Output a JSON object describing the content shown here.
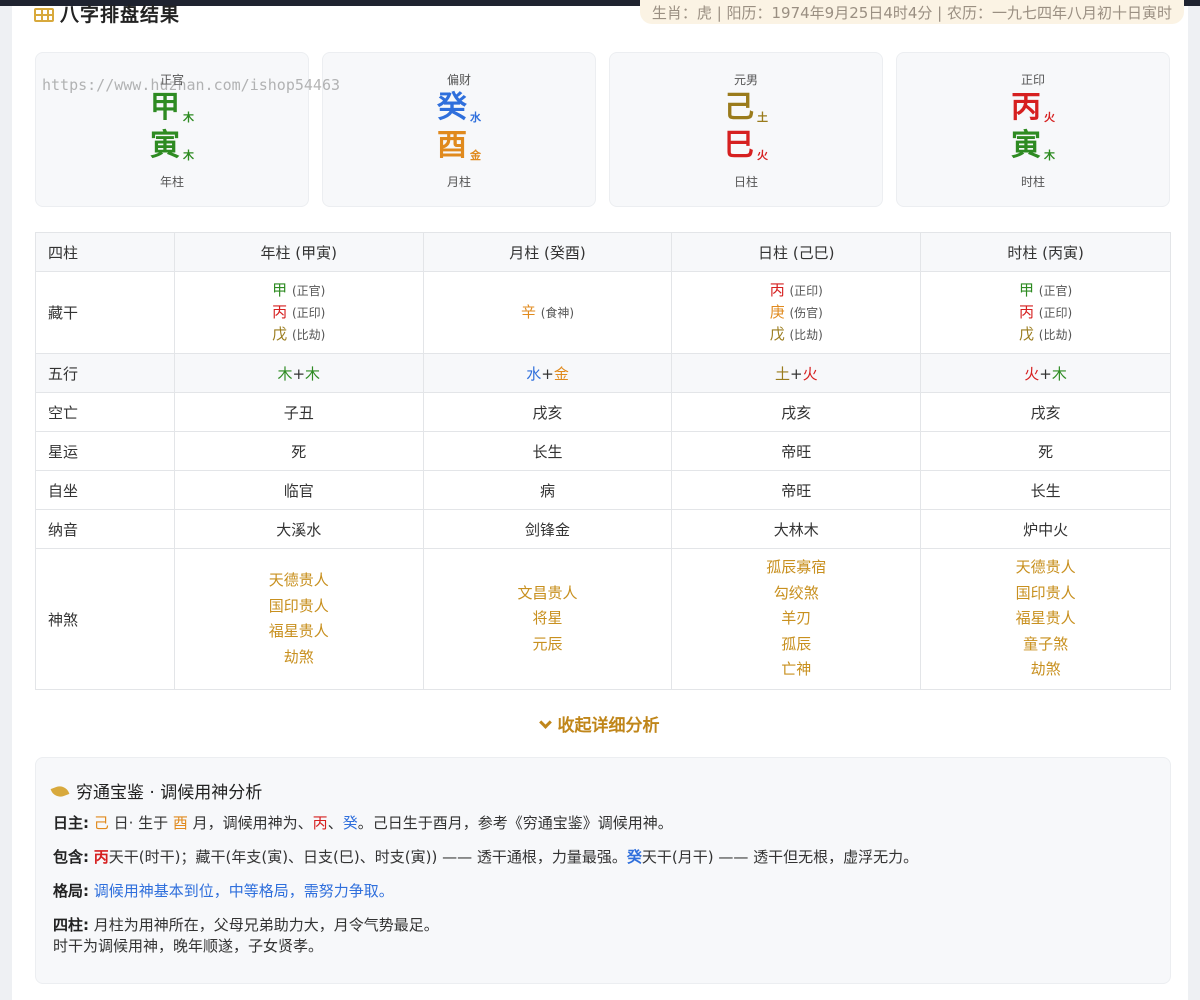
{
  "header": {
    "title": "八字排盘结果",
    "birth_info": "生肖：虎 | 阳历：1974年9月25日4时4分 | 农历：一九七四年八月初十日寅时"
  },
  "watermark": "https://www.huzhan.com/ishop54463",
  "pillars": [
    {
      "god": "正官",
      "stem": "甲",
      "stem_elem": "木",
      "branch": "寅",
      "branch_elem": "木",
      "name": "年柱"
    },
    {
      "god": "偏财",
      "stem": "癸",
      "stem_elem": "水",
      "branch": "酉",
      "branch_elem": "金",
      "name": "月柱"
    },
    {
      "god": "元男",
      "stem": "己",
      "stem_elem": "土",
      "branch": "巳",
      "branch_elem": "火",
      "name": "日柱"
    },
    {
      "god": "正印",
      "stem": "丙",
      "stem_elem": "火",
      "branch": "寅",
      "branch_elem": "木",
      "name": "时柱"
    }
  ],
  "table": {
    "headers": [
      "四柱",
      "年柱 (甲寅)",
      "月柱 (癸酉)",
      "日柱 (己巳)",
      "时柱 (丙寅)"
    ],
    "cang_label": "藏干",
    "cang": [
      [
        {
          "c": "甲",
          "g": "(正官)"
        },
        {
          "c": "丙",
          "g": "(正印)"
        },
        {
          "c": "戊",
          "g": "(比劫)"
        }
      ],
      [
        {
          "c": "辛",
          "g": "(食神)"
        }
      ],
      [
        {
          "c": "丙",
          "g": "(正印)"
        },
        {
          "c": "庚",
          "g": "(伤官)"
        },
        {
          "c": "戊",
          "g": "(比劫)"
        }
      ],
      [
        {
          "c": "甲",
          "g": "(正官)"
        },
        {
          "c": "丙",
          "g": "(正印)"
        },
        {
          "c": "戊",
          "g": "(比劫)"
        }
      ]
    ],
    "wuxing_label": "五行",
    "wuxing": [
      {
        "a": "木",
        "plus": "+",
        "b": "木"
      },
      {
        "a": "水",
        "plus": "+",
        "b": "金"
      },
      {
        "a": "土",
        "plus": "+",
        "b": "火"
      },
      {
        "a": "火",
        "plus": "+",
        "b": "木"
      }
    ],
    "kongwang_label": "空亡",
    "kongwang": [
      "子丑",
      "戌亥",
      "戌亥",
      "戌亥"
    ],
    "xingyun_label": "星运",
    "xingyun": [
      "死",
      "长生",
      "帝旺",
      "死"
    ],
    "zizuo_label": "自坐",
    "zizuo": [
      "临官",
      "病",
      "帝旺",
      "长生"
    ],
    "nayin_label": "纳音",
    "nayin": [
      "大溪水",
      "剑锋金",
      "大林木",
      "炉中火"
    ],
    "shensha_label": "神煞",
    "shensha": [
      [
        "天德贵人",
        "国印贵人",
        "福星贵人",
        "劫煞"
      ],
      [
        "文昌贵人",
        "将星",
        "元辰"
      ],
      [
        "孤辰寡宿",
        "勾绞煞",
        "羊刃",
        "孤辰",
        "亡神"
      ],
      [
        "天德贵人",
        "国印贵人",
        "福星贵人",
        "童子煞",
        "劫煞"
      ]
    ]
  },
  "collapse_label": "收起详细分析",
  "analysis": {
    "title": "穷通宝鉴 · 调候用神分析",
    "rizhu": {
      "key": "日主:",
      "p1": "己",
      "p2": " 日· 生于 ",
      "p3": "酉",
      "p4": " 月，调候用神为、",
      "p5": "丙",
      "p6": "、",
      "p7": "癸",
      "p8": "。己日生于酉月，参考《穷通宝鉴》调候用神。"
    },
    "baohan": {
      "key": "包含:",
      "p1": "丙",
      "p2": "天干(时干)；藏干(年支(寅)、日支(巳)、时支(寅)) —— 透干通根，力量最强。",
      "p3": "癸",
      "p4": "天干(月干) —— 透干但无根，虚浮无力。"
    },
    "geju": {
      "key": "格局:",
      "text": "调候用神基本到位，中等格局，需努力争取。"
    },
    "sizhu": {
      "key": "四柱:",
      "line1": "月柱为用神所在，父母兄弟助力大，月令气势最足。",
      "line2": "时干为调候用神，晚年顺遂，子女贤孝。"
    }
  },
  "colors": {
    "wood": "#2e8b22",
    "water": "#2f6fdc",
    "metal": "#e08a1e",
    "earth": "#9a7b1c",
    "fire": "#d62020",
    "gold": "#c8901f"
  }
}
